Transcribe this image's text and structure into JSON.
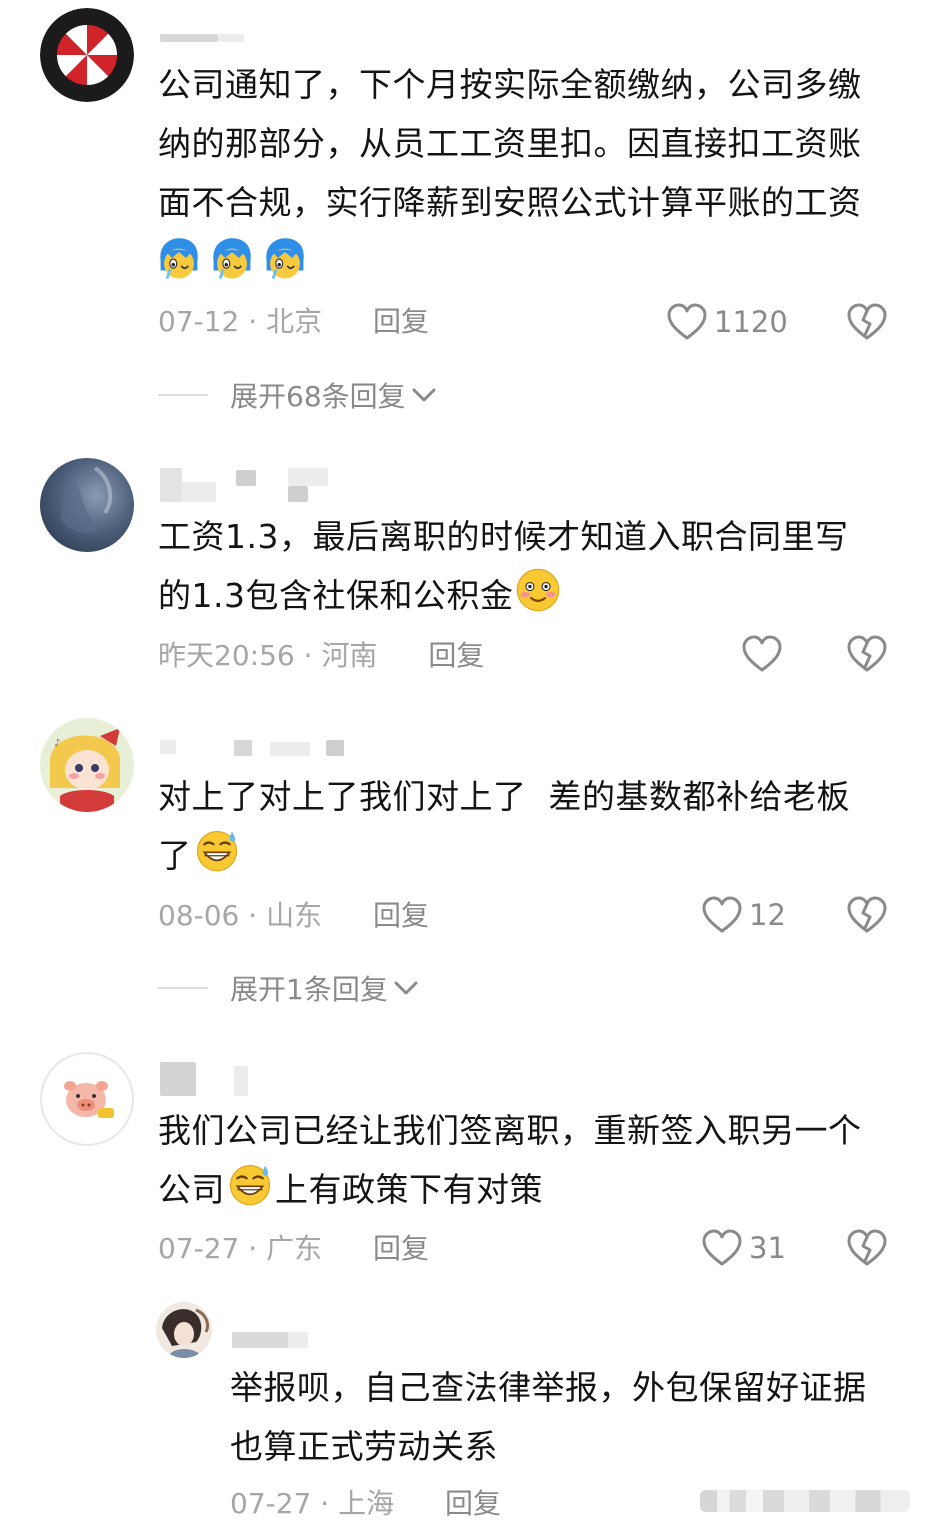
{
  "comments": [
    {
      "avatar": "umbrella-logo-avatar",
      "body_lines": [
        "公司通知了，下个月按实际全额缴纳，公司多缴",
        "纳的那部分，从员工工资里扣。因直接扣工资账",
        "面不合规，实行降薪到安照公式计算平账的工资"
      ],
      "emoji_line": [
        "blue-hair-crying-emoji",
        "blue-hair-crying-emoji",
        "blue-hair-crying-emoji"
      ],
      "date": "07-12",
      "location": "北京",
      "sep": " · ",
      "reply_label": "回复",
      "likes": "1120",
      "expand_label": "展开68条回复"
    },
    {
      "avatar": "cloud-sky-avatar",
      "body_line1": "工资1.3，最后离职的时候才知道入职合同里写",
      "body_line2": "的1.3包含社保和公积金",
      "emoji": "blushing-smile-emoji",
      "date": "昨天20:56",
      "location": "河南",
      "sep": " · ",
      "reply_label": "回复",
      "likes": ""
    },
    {
      "avatar": "anime-girl-avatar",
      "body_line1": "对上了对上了我们对上了  差的基数都补给老板",
      "body_line2": "了",
      "emoji": "grinning-sweat-emoji",
      "date": "08-06",
      "location": "山东",
      "sep": " · ",
      "reply_label": "回复",
      "likes": "12",
      "expand_label": "展开1条回复"
    },
    {
      "avatar": "pig-avatar",
      "body_line1": "我们公司已经让我们签离职，重新签入职另一个",
      "body_line2_pre": "公司",
      "emoji": "grinning-sweat-emoji",
      "body_line2_post": "上有政策下有对策",
      "date": "07-27",
      "location": "广东",
      "sep": " · ",
      "reply_label": "回复",
      "likes": "31"
    }
  ],
  "reply": {
    "avatar": "illustrated-person-avatar",
    "body_line1": "举报呗，自己查法律举报，外包保留好证据",
    "body_line2": "也算正式劳动关系",
    "date": "07-27",
    "location": "上海",
    "sep": " · ",
    "reply_label": "回复"
  },
  "icons": {
    "like": "heart-outline-icon",
    "dislike": "broken-heart-icon",
    "expand": "chevron-down-icon"
  },
  "colors": {
    "meta_text": "#a6a6a6",
    "body_text": "#141414",
    "icon": "#8a8a8a"
  }
}
